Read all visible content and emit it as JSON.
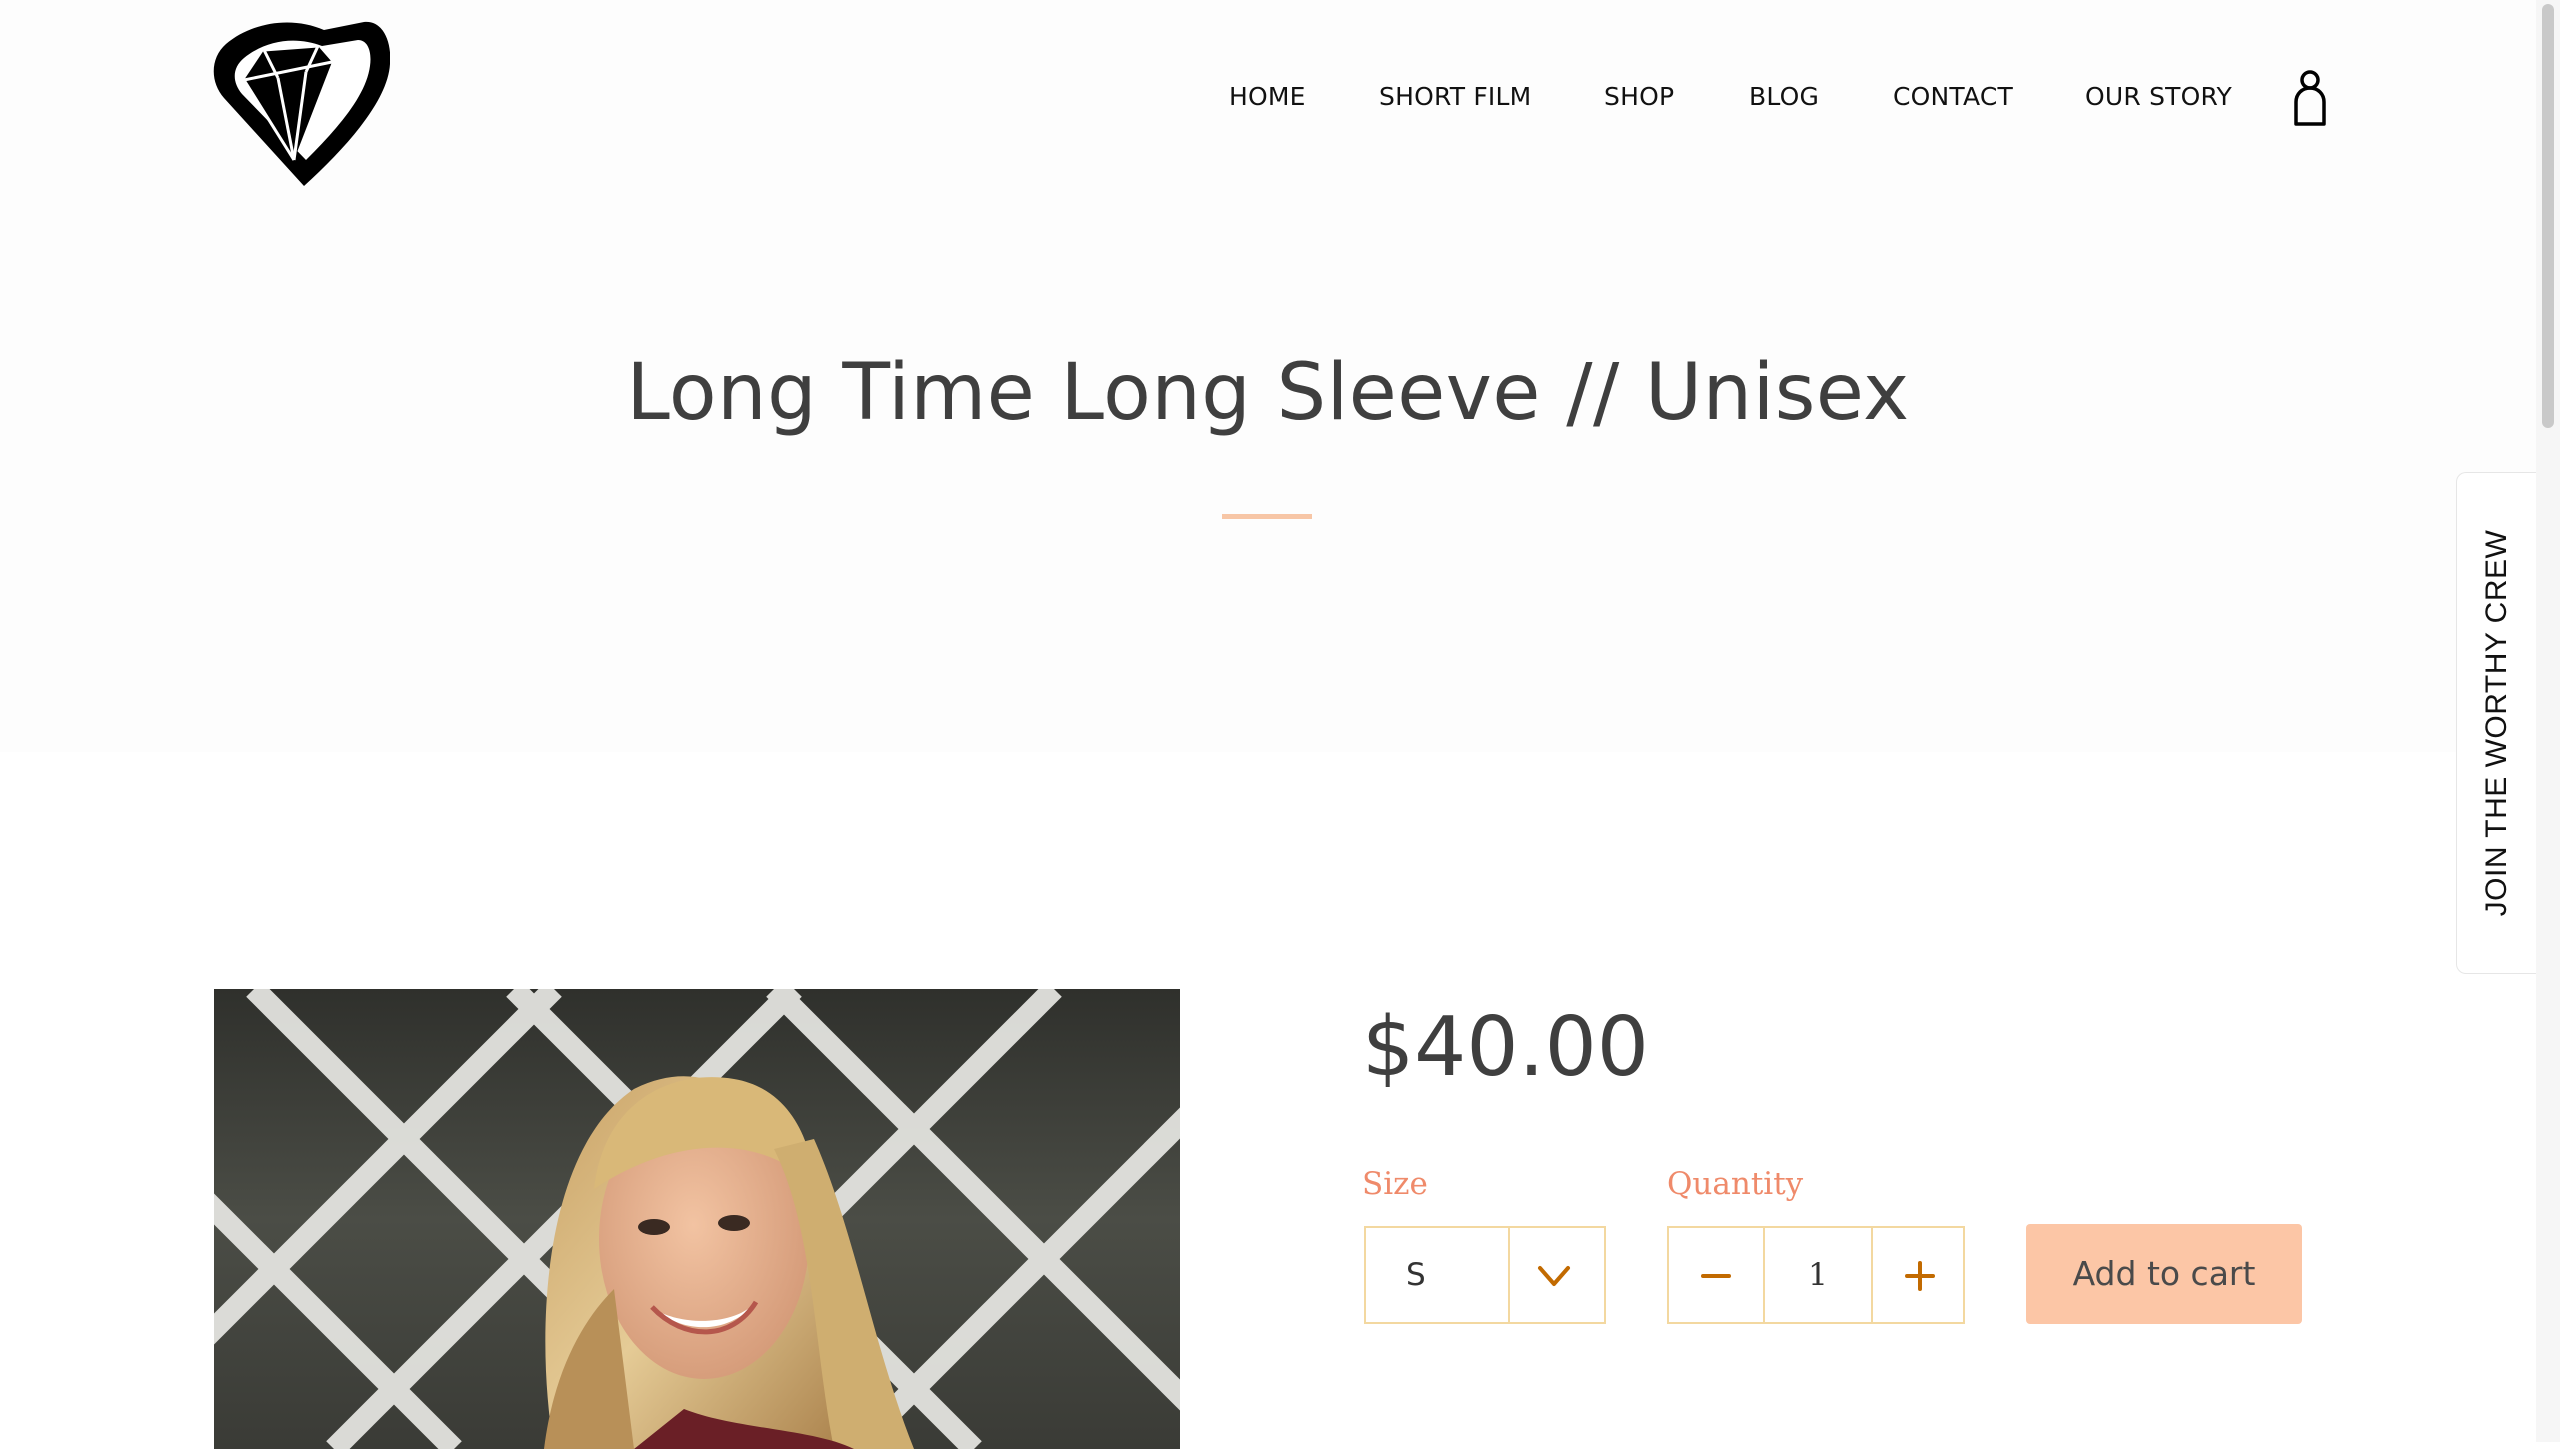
{
  "nav": {
    "items": [
      {
        "label": "HOME"
      },
      {
        "label": "SHORT FILM"
      },
      {
        "label": "SHOP"
      },
      {
        "label": "BLOG"
      },
      {
        "label": "CONTACT"
      },
      {
        "label": "OUR STORY"
      }
    ],
    "account_icon": "account-person-icon",
    "logo_icon": "diamond-heart-logo"
  },
  "product": {
    "title": "Long Time Long Sleeve // Unisex",
    "price": "$40.00",
    "size_label": "Size",
    "size_value": "S",
    "quantity_label": "Quantity",
    "quantity_value": "1",
    "add_to_cart_label": "Add to cart"
  },
  "side_tab": {
    "label": "JOIN THE WORTHY CREW"
  },
  "colors": {
    "accent": "#fcc6a6",
    "label": "#ef8a6a",
    "field_border": "#f3d8a0",
    "icon": "#c26a00"
  }
}
